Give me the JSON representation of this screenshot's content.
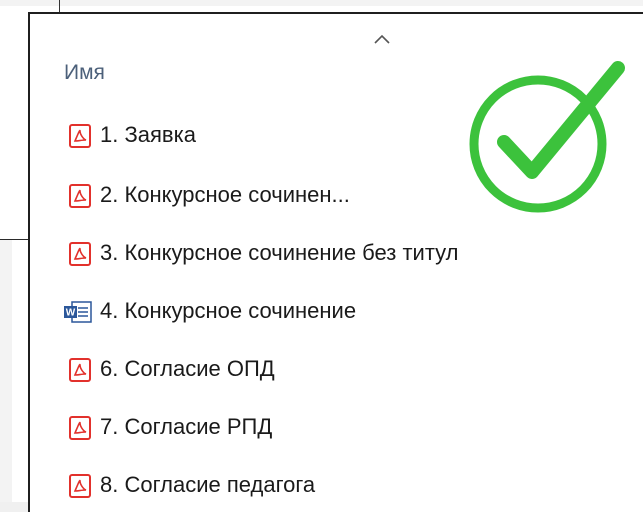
{
  "header": {
    "column_name": "Имя"
  },
  "files": [
    {
      "name": "1. Заявка",
      "icon": "pdf-icon"
    },
    {
      "name": "2. Конкурсное сочинен...",
      "icon": "pdf-icon"
    },
    {
      "name": "3. Конкурсное сочинение без титул",
      "icon": "pdf-icon"
    },
    {
      "name": "4. Конкурсное сочинение",
      "icon": "word-icon"
    },
    {
      "name": "6. Согласие ОПД",
      "icon": "pdf-icon"
    },
    {
      "name": "7. Согласие РПД",
      "icon": "pdf-icon"
    },
    {
      "name": "8. Согласие педагога",
      "icon": "pdf-icon"
    }
  ],
  "colors": {
    "pdf": "#e2312c",
    "word": "#2b579a",
    "check": "#3cc23c",
    "header_text": "#4c607a"
  }
}
